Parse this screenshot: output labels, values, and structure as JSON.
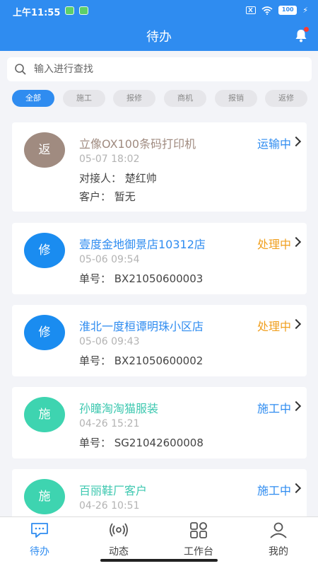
{
  "status_bar": {
    "time": "上午11:55",
    "battery": "100"
  },
  "header": {
    "title": "待办"
  },
  "search": {
    "placeholder": "输入进行查找"
  },
  "filters": [
    "全部",
    "施工",
    "报修",
    "商机",
    "报销",
    "返修"
  ],
  "cards": [
    {
      "avatar": "返",
      "avatar_color": "#a08b80",
      "title": "立像OX100条码打印机",
      "title_color": "#a08b80",
      "status": "运输中",
      "status_color": "#2f8cf0",
      "time": "05-07 18:02",
      "lines": [
        "对接人：  楚红帅",
        "客户：  暂无"
      ]
    },
    {
      "avatar": "修",
      "avatar_color": "#1a8cf0",
      "title": "壹度金地御景店10312店",
      "title_color": "#2f8cf0",
      "status": "处理中",
      "status_color": "#f0a020",
      "time": "05-06 09:54",
      "lines": [
        "单号：  BX21050600003"
      ]
    },
    {
      "avatar": "修",
      "avatar_color": "#1a8cf0",
      "title": "淮北一度桓谭明珠小区店",
      "title_color": "#2f8cf0",
      "status": "处理中",
      "status_color": "#f0a020",
      "time": "05-06 09:43",
      "lines": [
        "单号：  BX21050600002"
      ]
    },
    {
      "avatar": "施",
      "avatar_color": "#3ed4b0",
      "title": "孙瞳淘淘猫服装",
      "title_color": "#3ec8b0",
      "status": "施工中",
      "status_color": "#2f8cf0",
      "time": "04-26 15:21",
      "lines": [
        "单号：  SG21042600008"
      ]
    },
    {
      "avatar": "施",
      "avatar_color": "#3ed4b0",
      "title": "百丽鞋厂客户",
      "title_color": "#3ec8b0",
      "status": "施工中",
      "status_color": "#2f8cf0",
      "time": "04-26 10:51",
      "lines": []
    }
  ],
  "nav": [
    {
      "label": "待办",
      "icon": "chat-icon",
      "active": true
    },
    {
      "label": "动态",
      "icon": "broadcast-icon",
      "active": false
    },
    {
      "label": "工作台",
      "icon": "grid-icon",
      "active": false
    },
    {
      "label": "我的",
      "icon": "user-icon",
      "active": false
    }
  ],
  "colors": {
    "primary": "#2f8cf0",
    "background": "#f3f4f8"
  }
}
